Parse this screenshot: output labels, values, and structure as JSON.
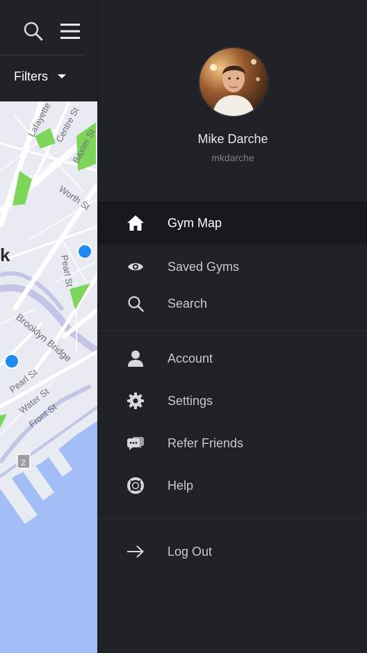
{
  "map_screen": {
    "filters_label": "Filters",
    "map_labels": {
      "street_lafayette": "Lafayette",
      "street_centre": "Centre St",
      "street_baxter": "Baxter St",
      "street_worth": "Worth St",
      "street_pearl_upper": "Pearl St",
      "street_brooklyn_bridge": "Brooklyn Bridge",
      "street_pearl_lower": "Pearl St",
      "street_water": "Water St",
      "street_front": "Front St",
      "district_letter": "k",
      "route_shield": "2"
    },
    "colors": {
      "land": "#e9ebf2",
      "water": "#a3bdf6",
      "park": "#7dd65a",
      "marker": "#1d8bf0"
    }
  },
  "profile": {
    "name": "Mike Darche",
    "username": "mkdarche"
  },
  "nav": {
    "items": [
      {
        "label": "Gym Map",
        "icon": "home-icon",
        "active": true
      },
      {
        "label": "Saved Gyms",
        "icon": "eye-icon",
        "active": false
      },
      {
        "label": "Search",
        "icon": "search-icon",
        "active": false
      },
      {
        "label": "Account",
        "icon": "person-icon",
        "active": false
      },
      {
        "label": "Settings",
        "icon": "gear-icon",
        "active": false
      },
      {
        "label": "Refer Friends",
        "icon": "chat-bubbles-icon",
        "active": false
      },
      {
        "label": "Help",
        "icon": "lifebuoy-icon",
        "active": false
      },
      {
        "label": "Log Out",
        "icon": "arrow-right-icon",
        "active": false
      }
    ]
  },
  "colors": {
    "drawer_bg": "#1f2126",
    "active_row_bg": "#17181b",
    "label_text": "#c7c9ce",
    "active_label_text": "#ffffff",
    "icon": "#d7d8dc"
  }
}
